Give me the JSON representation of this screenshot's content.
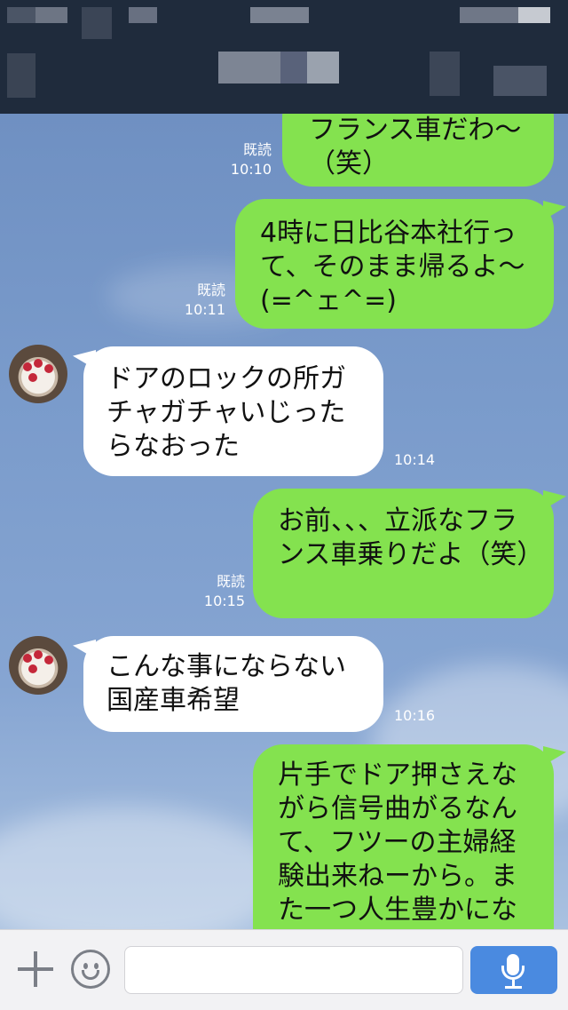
{
  "header": {
    "title": "",
    "note": ""
  },
  "messages": [
    {
      "id": "m1",
      "from": "me",
      "text": "フランス車だわ〜\n（笑）",
      "read": "既読",
      "time": "10:10"
    },
    {
      "id": "m2",
      "from": "me",
      "text": "4時に日比谷本社行って、そのまま帰るよ〜(=^ェ^=)",
      "read": "既読",
      "time": "10:11"
    },
    {
      "id": "m3",
      "from": "friend",
      "text": "ドアのロックの所ガチャガチャいじったらなおった",
      "time": "10:14"
    },
    {
      "id": "m4",
      "from": "me",
      "text": "お前、、、立派なフランス車乗りだよ（笑）",
      "read": "既読",
      "time": "10:15"
    },
    {
      "id": "m5",
      "from": "friend",
      "text": "こんな事にならない国産車希望",
      "time": "10:16"
    },
    {
      "id": "m6",
      "from": "me",
      "text": "片手でドア押さえながら信号曲がるなんて、フツーの主婦経験出来ねーから。また一つ人生豊かにな",
      "time": ""
    }
  ],
  "input": {
    "value": "",
    "placeholder": ""
  },
  "icons": {
    "add": "plus-icon",
    "sticker": "smiley-icon",
    "voice": "microphone-icon"
  },
  "colors": {
    "outgoing_bubble": "#84e24f",
    "incoming_bubble": "#ffffff",
    "header_bg": "#1f2b3c",
    "send_button": "#4a8ae0"
  }
}
